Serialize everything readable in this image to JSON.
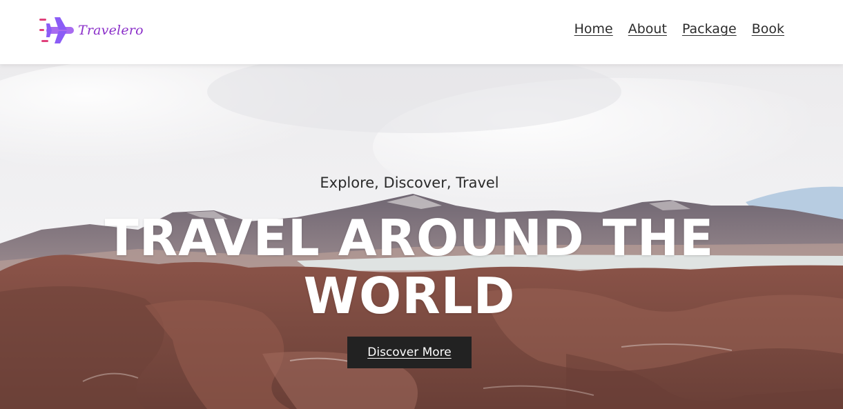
{
  "brand": {
    "name": "Travelero",
    "icon": "airplane-icon",
    "colors": {
      "primary": "#8b2fc9",
      "accent": "#e0407a",
      "plane": "#a86bf0"
    }
  },
  "nav": {
    "items": [
      {
        "label": "Home"
      },
      {
        "label": "About"
      },
      {
        "label": "Package"
      },
      {
        "label": "Book"
      }
    ]
  },
  "hero": {
    "subtitle": "Explore, Discover, Travel",
    "title": "TRAVEL AROUND THE WORLD",
    "cta_label": "Discover More",
    "cta_color": "#222222"
  }
}
